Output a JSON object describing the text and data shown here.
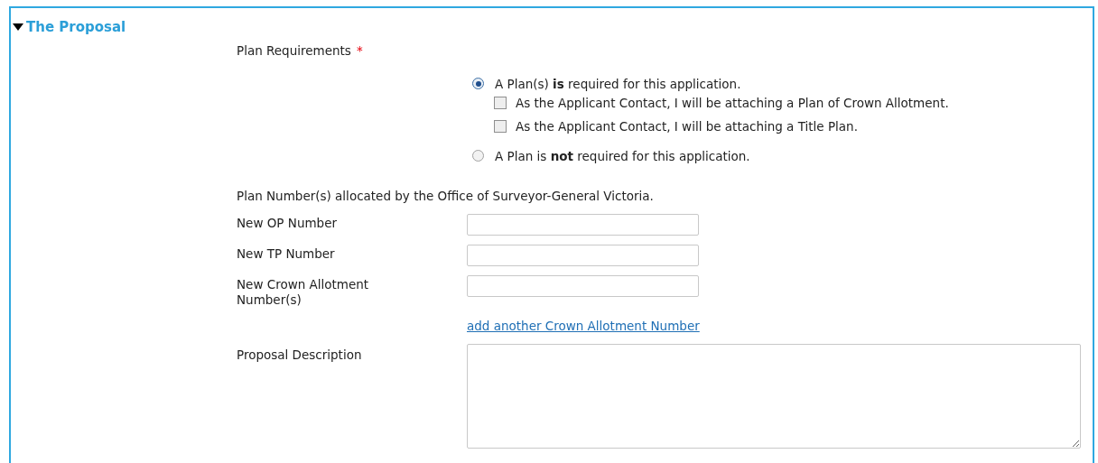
{
  "section": {
    "title": "The Proposal",
    "expanded": true
  },
  "plan_requirements": {
    "label": "Plan Requirements",
    "required_mark": "*",
    "options": [
      {
        "label": "A Plan(s) **is** required for this application.",
        "selected": true,
        "checkboxes": [
          {
            "label": "As the Applicant Contact, I will be attaching a Plan of Crown Allotment.",
            "checked": false
          },
          {
            "label": "As the Applicant Contact, I will be attaching a Title Plan.",
            "checked": false
          }
        ]
      },
      {
        "label": "A Plan is **not** required for this application.",
        "selected": false
      }
    ]
  },
  "plan_numbers": {
    "intro": "Plan Number(s) allocated by the Office of Surveyor-General Victoria.",
    "fields": [
      {
        "label": "New OP Number"
      },
      {
        "label": "New TP Number"
      },
      {
        "label": "New Crown Allotment Number(s)"
      }
    ],
    "add_link": "add another Crown Allotment Number"
  },
  "description": {
    "label": "Proposal Description"
  }
}
